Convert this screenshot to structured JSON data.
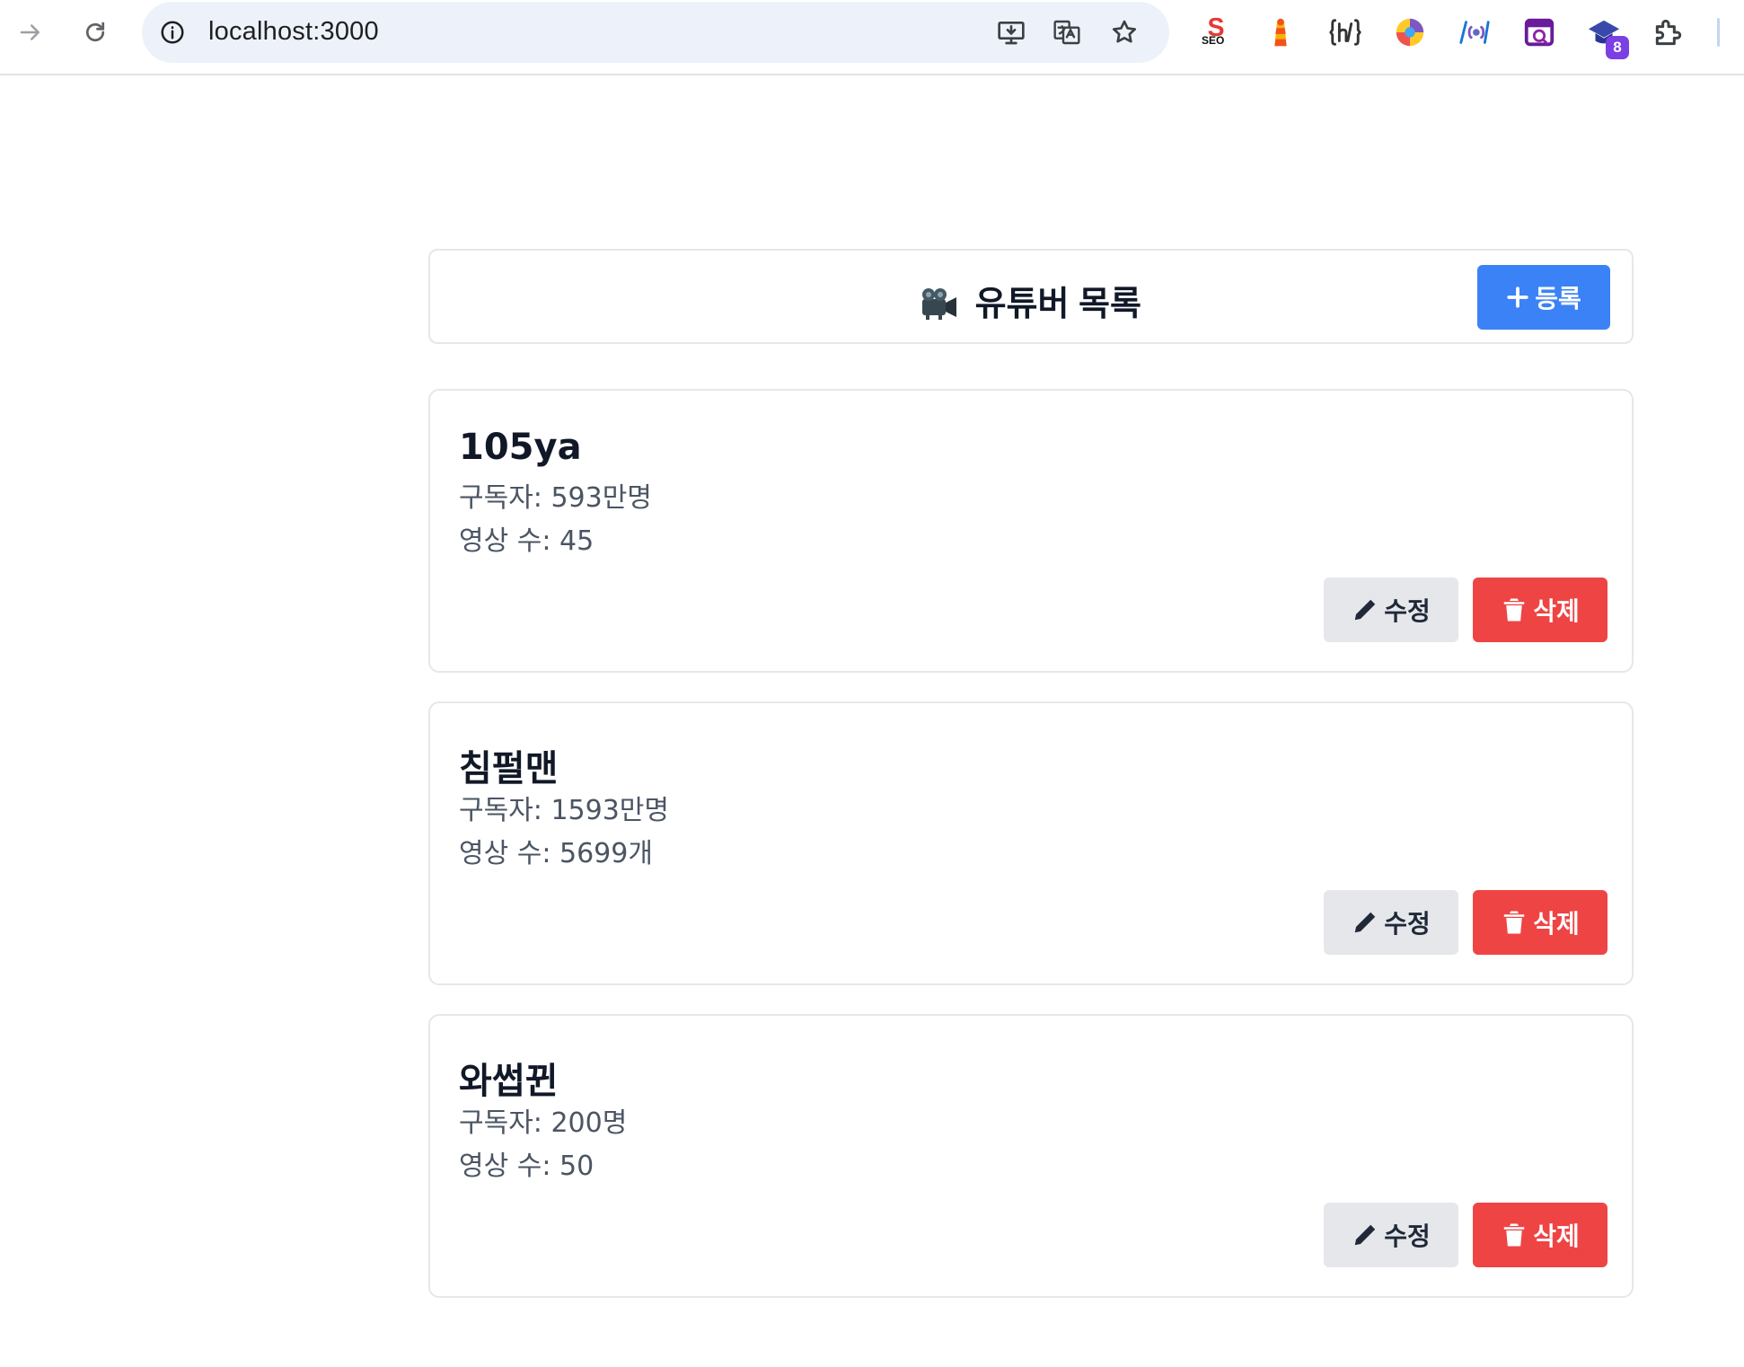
{
  "browser": {
    "url": "localhost:3000",
    "extensions_badge": "8",
    "extension_seo_label": "SEO"
  },
  "header": {
    "title": "유튜버 목록",
    "add_label": "등록"
  },
  "youtubers": [
    {
      "name": "105ya",
      "subscribers": "구독자: 593만명",
      "videos": "영상 수: 45"
    },
    {
      "name": "침펄맨",
      "subscribers": "구독자: 1593만명",
      "videos": "영상 수: 5699개"
    },
    {
      "name": "와썹뀐",
      "subscribers": "구독자: 200명",
      "videos": "영상 수: 50"
    }
  ],
  "actions": {
    "edit_label": "수정",
    "delete_label": "삭제"
  },
  "colors": {
    "primary": "#3b82f6",
    "danger": "#ef4444",
    "secondary": "#e5e7eb"
  }
}
